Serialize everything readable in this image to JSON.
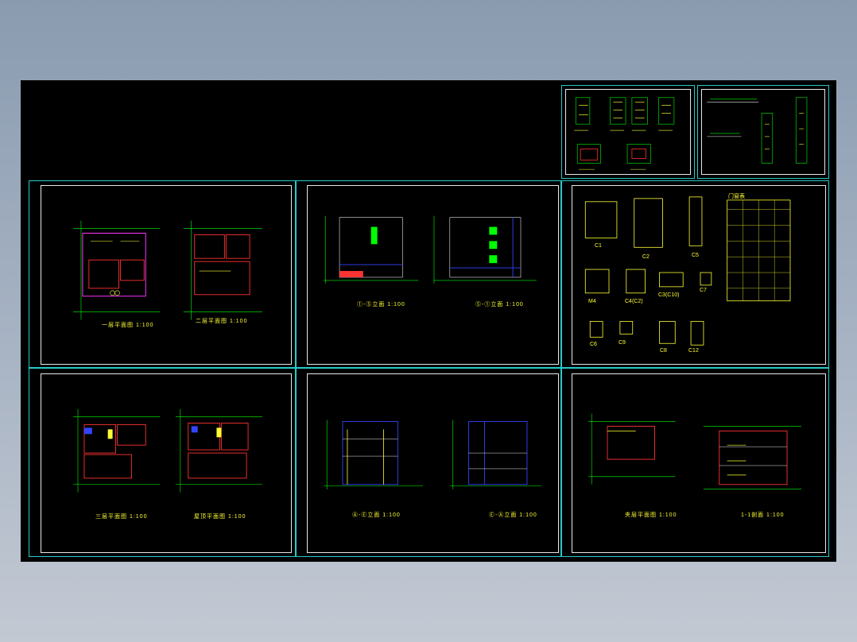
{
  "colors": {
    "background_top": "#8a9bb0",
    "background_bottom": "#c3c9d3",
    "model_space": "#000000",
    "sheet_border": "#29c9c9",
    "inner_border": "#e8e8e8",
    "dimension_lines": "#00ff00",
    "annotation_text": "#ffff33",
    "walls": "#ff3333",
    "accent_magenta": "#ff33ff",
    "accent_blue": "#3344ff"
  },
  "sheets": {
    "s1": {
      "caption_a": "一层平面图 1:100",
      "caption_b": "二层平面图 1:100"
    },
    "s2": {
      "caption_a": "①-⑤立面 1:100",
      "caption_b": "⑤-①立面 1:100"
    },
    "s3": {
      "labels": [
        "C1",
        "C2",
        "C5",
        "M4",
        "C4(C2)",
        "C3(C10)",
        "C7",
        "C6",
        "C9",
        "C8",
        "C12"
      ],
      "table_title": "门窗表"
    },
    "s4": {
      "caption_a": "三层平面图 1:100",
      "caption_b": "屋顶平面图 1:100"
    },
    "s5": {
      "caption_a": "Ⓐ-Ⓔ立面 1:100",
      "caption_b": "Ⓔ-Ⓐ立面 1:100"
    },
    "s6": {
      "caption_a": "夹层平面图 1:100",
      "caption_b": "1-1剖面 1:100"
    }
  }
}
